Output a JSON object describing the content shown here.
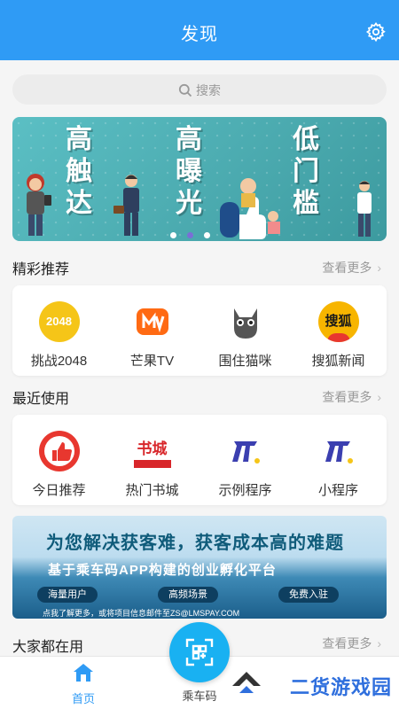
{
  "header": {
    "title": "发现"
  },
  "search": {
    "placeholder": "搜索"
  },
  "banner1": {
    "columns": [
      {
        "text": "高\n触\n达"
      },
      {
        "text": "高\n曝\n光"
      },
      {
        "text": "低\n门\n槛"
      }
    ],
    "active_dot": 2
  },
  "featured": {
    "title": "精彩推荐",
    "more": "查看更多",
    "apps": [
      {
        "label": "挑战2048",
        "icon": "2048-icon",
        "icon_text": "2048",
        "color": "#f5c518"
      },
      {
        "label": "芒果TV",
        "icon": "mango-tv-icon",
        "color": "#ff6a13"
      },
      {
        "label": "围住猫咪",
        "icon": "cat-icon",
        "color": "#555555"
      },
      {
        "label": "搜狐新闻",
        "icon": "sohu-icon",
        "icon_text": "搜狐",
        "color": "#f7b500"
      }
    ]
  },
  "recent": {
    "title": "最近使用",
    "more": "查看更多",
    "apps": [
      {
        "label": "今日推荐",
        "icon": "thumbs-up-icon",
        "color": "#e8372f"
      },
      {
        "label": "热门书城",
        "icon": "bookstore-icon",
        "icon_text": "书城",
        "color": "#d8262a"
      },
      {
        "label": "示例程序",
        "icon": "mini-program-icon",
        "color": "#3b3fb0"
      },
      {
        "label": "小程序",
        "icon": "mini-program-icon",
        "color": "#3b3fb0"
      }
    ]
  },
  "banner2": {
    "line1": "为您解决获客难，获客成本高的难题",
    "line2": "基于乘车码APP构建的创业孵化平台",
    "pills": [
      "海量用户",
      "高频场景",
      "免费入驻"
    ],
    "line3": "点我了解更多，或将项目信息邮件至ZS@LMSPAY.COM"
  },
  "popular": {
    "title": "大家都在用",
    "more": "查看更多"
  },
  "nav": {
    "home": "首页",
    "ride_code": "乘车码",
    "active_color": "#2f9bf5"
  },
  "watermark": "二货游戏园"
}
